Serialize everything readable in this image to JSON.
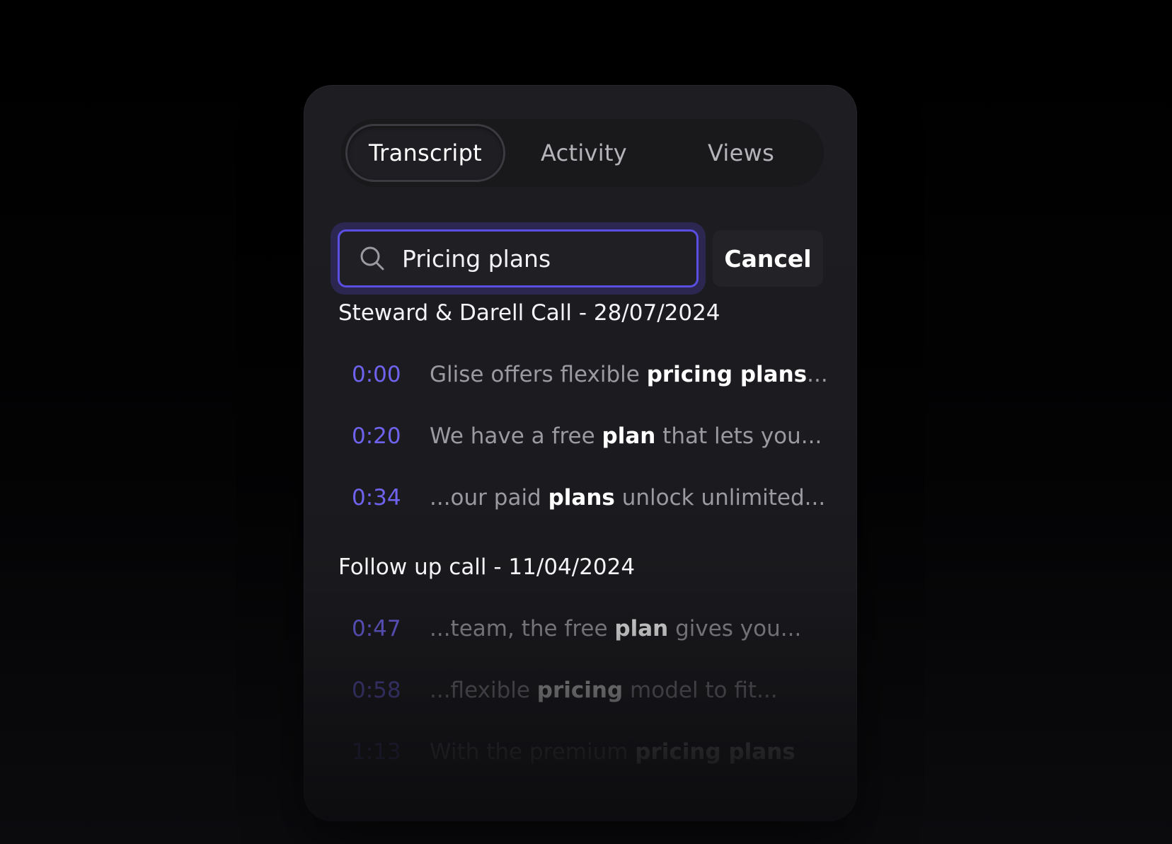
{
  "tabs": [
    {
      "label": "Transcript",
      "active": true
    },
    {
      "label": "Activity",
      "active": false
    },
    {
      "label": "Views",
      "active": false
    }
  ],
  "search": {
    "value": "Pricing plans",
    "icon": "search-icon",
    "cancel_label": "Cancel"
  },
  "sections": [
    {
      "title": "Steward & Darell Call - 28/07/2024",
      "results": [
        {
          "time": "0:00",
          "pre": "Glise offers flexible ",
          "match": "pricing plans",
          "post": "..."
        },
        {
          "time": "0:20",
          "pre": "We have a free ",
          "match": "plan",
          "post": " that lets you..."
        },
        {
          "time": "0:34",
          "pre": "...our paid ",
          "match": "plans",
          "post": " unlock unlimited..."
        }
      ]
    },
    {
      "title": "Follow up call - 11/04/2024",
      "results": [
        {
          "time": "0:47",
          "pre": "...team, the free ",
          "match": "plan",
          "post": " gives you..."
        },
        {
          "time": "0:58",
          "pre": "...flexible ",
          "match": "pricing",
          "post": " model to fit..."
        },
        {
          "time": "1:13",
          "pre": "With the premium ",
          "match": "pricing plans",
          "post": ""
        }
      ]
    }
  ],
  "colors": {
    "accent": "#5b4ee2",
    "timestamp": "#6f63ee",
    "panel": "#1e1e22",
    "background": "#000000"
  }
}
